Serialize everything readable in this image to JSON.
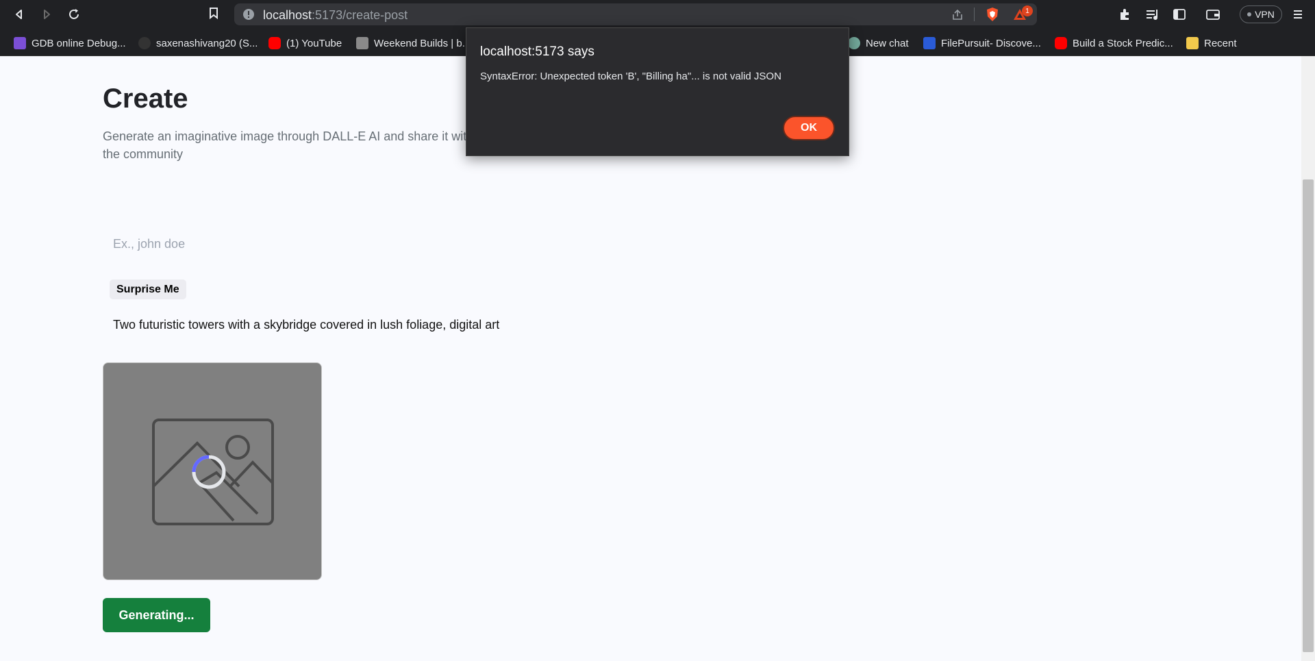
{
  "browser": {
    "url_host": "localhost",
    "url_path": ":5173/create-post",
    "vpn_label": "VPN",
    "notification_count": "1",
    "bookmarks": [
      {
        "label": "GDB online Debug...",
        "icon": "gdb-icon",
        "color": "#7b4fd6"
      },
      {
        "label": "saxenashivang20 (S...",
        "icon": "github-icon",
        "color": "#333333"
      },
      {
        "label": "(1) YouTube",
        "icon": "youtube-icon",
        "color": "#ff0000"
      },
      {
        "label": "Weekend Builds | b...",
        "icon": "builds-icon",
        "color": "#8a8a8a"
      },
      {
        "label": "New chat",
        "icon": "chatgpt-icon",
        "color": "#74aa9c"
      },
      {
        "label": "FilePursuit- Discove...",
        "icon": "filepursuit-icon",
        "color": "#2a5bd7"
      },
      {
        "label": "Build a Stock Predic...",
        "icon": "youtube-icon",
        "color": "#ff0000"
      },
      {
        "label": "Recent",
        "icon": "folder-icon",
        "color": "#f2c94c"
      }
    ]
  },
  "page": {
    "title": "Create",
    "subtitle": "Generate an imaginative image through DALL-E AI and share it with the community",
    "name_placeholder": "Ex., john doe",
    "surprise_label": "Surprise Me",
    "prompt_text": "Two futuristic towers with a skybridge covered in lush foliage, digital art",
    "generate_label": "Generating..."
  },
  "dialog": {
    "title": "localhost:5173 says",
    "message": "SyntaxError: Unexpected token 'B', \"Billing ha\"... is not valid JSON",
    "ok_label": "OK"
  },
  "colors": {
    "accent": "#fb542b",
    "generate": "#15803d"
  }
}
